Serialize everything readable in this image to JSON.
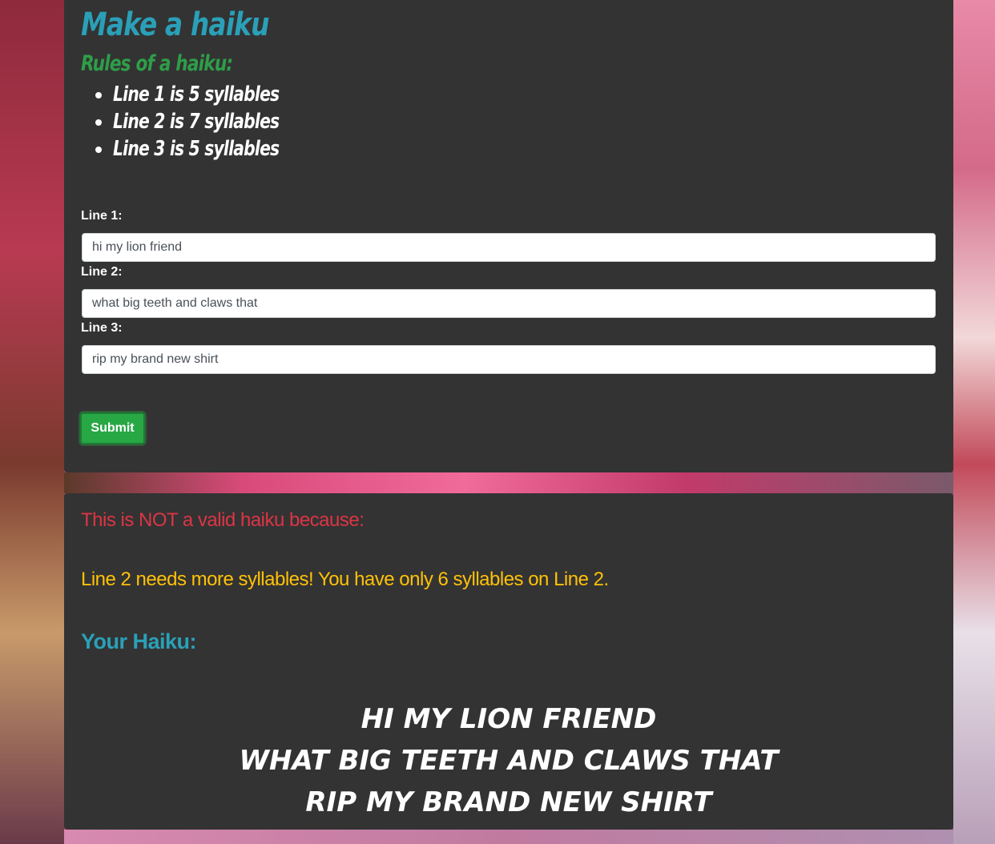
{
  "form": {
    "title": "Make a haiku",
    "rules_title": "Rules of a haiku:",
    "rules": [
      "Line 1 is 5 syllables",
      "Line 2 is 7 syllables",
      "Line 3 is 5 syllables"
    ],
    "fields": [
      {
        "label": "Line 1:",
        "value": "hi my lion friend"
      },
      {
        "label": "Line 2:",
        "value": "what big teeth and claws that"
      },
      {
        "label": "Line 3:",
        "value": "rip my brand new shirt"
      }
    ],
    "submit_label": "Submit"
  },
  "result": {
    "invalid_title": "This is NOT a valid haiku because:",
    "error_message": "Line 2 needs more syllables! You have only 6 syllables on Line 2.",
    "your_haiku_title": "Your Haiku:",
    "haiku_lines": [
      "hi my lion friend",
      "what big teeth and claws that",
      "rip my brand new shirt"
    ]
  },
  "colors": {
    "panel_bg": "#333333",
    "title": "#2aa0b8",
    "rules_title": "#2e9e48",
    "error_title": "#dc3545",
    "warning": "#ffc107",
    "submit": "#28a745"
  }
}
